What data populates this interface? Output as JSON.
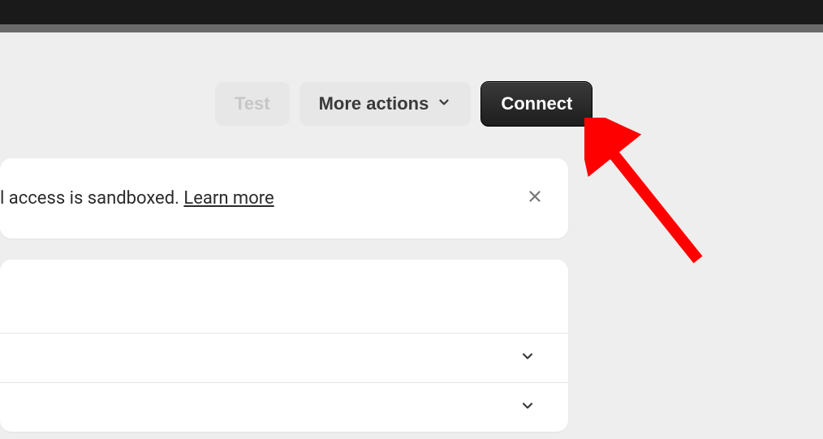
{
  "toolbar": {
    "test_label": "Test",
    "more_actions_label": "More actions",
    "connect_label": "Connect"
  },
  "notice": {
    "text_fragment": "l access is sandboxed. ",
    "learn_more_label": "Learn more"
  },
  "annotation": {
    "arrow_color": "#ff0000"
  }
}
